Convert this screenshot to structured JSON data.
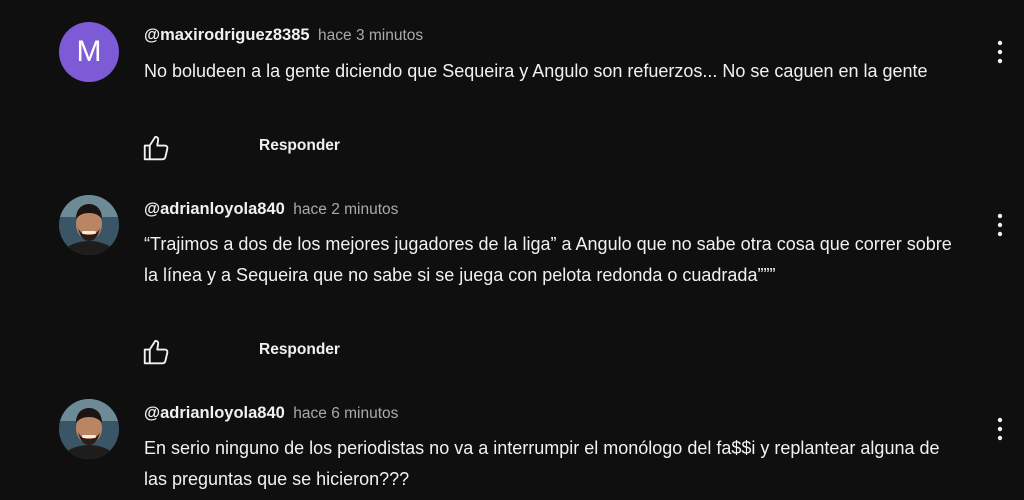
{
  "comments": [
    {
      "avatar_letter": "M",
      "avatar_color": "#7e5bd6",
      "author": "@maxirodriguez8385",
      "time": "hace 3 minutos",
      "text": "No boludeen a la gente diciendo que Sequeira y Angulo son refuerzos... No se caguen en la gente",
      "reply_label": "Responder"
    },
    {
      "avatar_icon": "user-photo",
      "author": "@adrianloyola840",
      "time": "hace 2 minutos",
      "text": "“Trajimos a dos de los mejores jugadores de la liga” a Angulo que no sabe otra cosa que correr sobre la línea y a Sequeira que no sabe si se juega con pelota redonda o cuadrada”””",
      "reply_label": "Responder"
    },
    {
      "avatar_icon": "user-photo",
      "author": "@adrianloyola840",
      "time": "hace 6 minutos",
      "text": "En serio ninguno de los periodistas no va a interrumpir el monólogo del fa$$i y replantear alguna de las preguntas que se hicieron???"
    }
  ],
  "icons": {
    "like": "thumb-up-icon",
    "menu": "more-vert-icon"
  },
  "colors": {
    "background": "#0f0f0f",
    "text": "#f1f1f1",
    "secondary_text": "#aaaaaa"
  }
}
